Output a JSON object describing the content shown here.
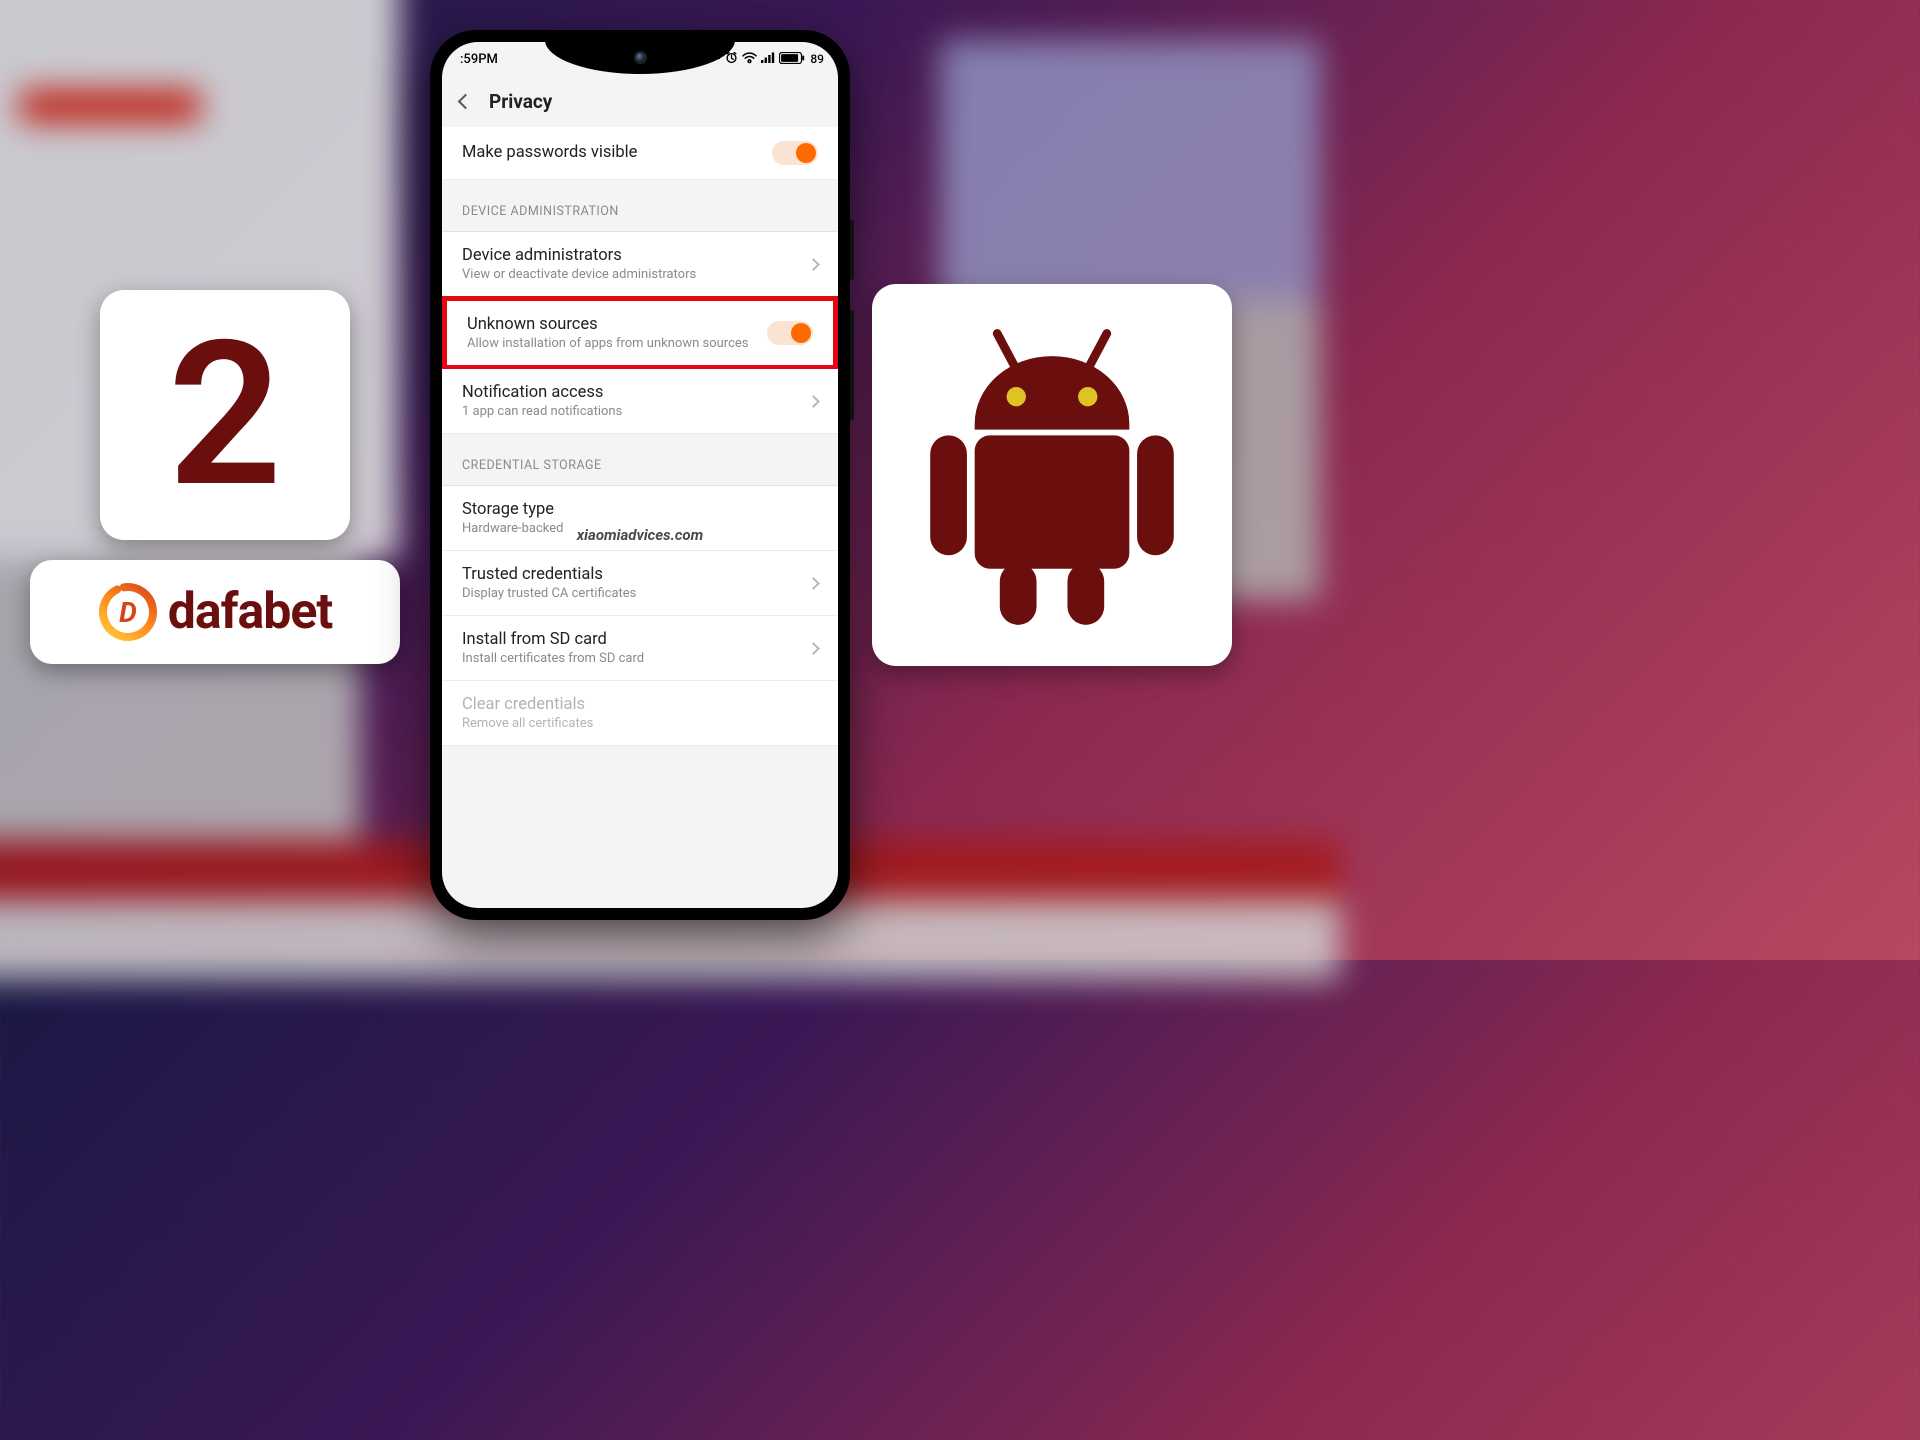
{
  "step": {
    "number": "2"
  },
  "brand": {
    "name": "dafabet",
    "initial": "D"
  },
  "status": {
    "time": ":59PM",
    "battery_pct": "89"
  },
  "header": {
    "title": "Privacy"
  },
  "sections": {
    "sec0": {
      "row0": {
        "title": "Make passwords visible"
      }
    },
    "sec1": {
      "label": "DEVICE ADMINISTRATION",
      "row0": {
        "title": "Device administrators",
        "sub": "View or deactivate device administrators"
      },
      "row1": {
        "title": "Unknown sources",
        "sub": "Allow installation of apps from unknown sources"
      },
      "row2": {
        "title": "Notification access",
        "sub": "1 app can read notifications"
      }
    },
    "sec2": {
      "label": "CREDENTIAL STORAGE",
      "row0": {
        "title": "Storage type",
        "sub": "Hardware-backed"
      },
      "row1": {
        "title": "Trusted credentials",
        "sub": "Display trusted CA certificates"
      },
      "row2": {
        "title": "Install from SD card",
        "sub": "Install certificates from SD card"
      },
      "row3": {
        "title": "Clear credentials",
        "sub": "Remove all certificates"
      }
    }
  },
  "watermark": "xiaomiadvices.com"
}
